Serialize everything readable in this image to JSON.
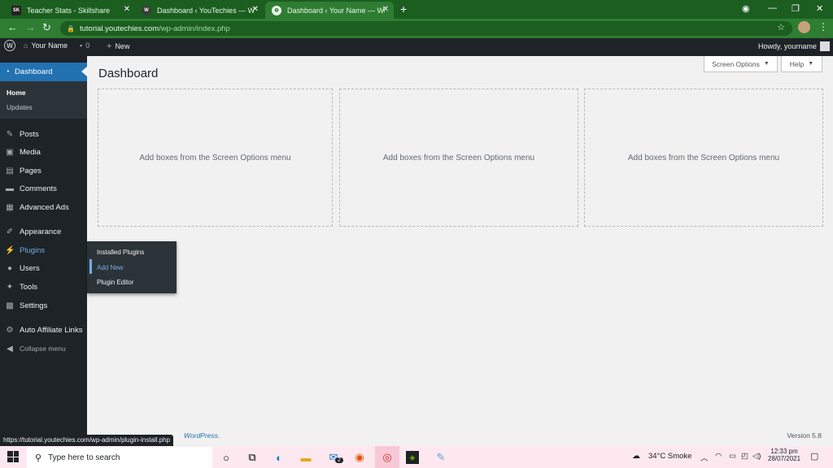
{
  "browser": {
    "tabs": [
      {
        "title": "Teacher Stats - Skillshare",
        "favicon": "SK",
        "active": false
      },
      {
        "title": "Dashboard ‹ YouTechies — Word",
        "favicon": "wordpress-icon",
        "active": false
      },
      {
        "title": "Dashboard ‹ Your Name — Word",
        "favicon": "globe-icon",
        "active": true
      }
    ],
    "new_tab_glyph": "+",
    "url_host": "tutorial.youtechies.com",
    "url_path": "/wp-admin/index.php"
  },
  "admin_bar": {
    "site_name": "Your Name",
    "comments_count": "0",
    "new_label": "New",
    "howdy": "Howdy, yourname"
  },
  "sidebar": {
    "dashboard_label": "Dashboard",
    "dashboard_sub": [
      "Home",
      "Updates"
    ],
    "items": [
      {
        "label": "Posts",
        "icon": "pin-icon"
      },
      {
        "label": "Media",
        "icon": "media-icon"
      },
      {
        "label": "Pages",
        "icon": "pages-icon"
      },
      {
        "label": "Comments",
        "icon": "comment-icon"
      },
      {
        "label": "Advanced Ads",
        "icon": "ads-icon"
      },
      {
        "label": "Appearance",
        "icon": "brush-icon"
      },
      {
        "label": "Plugins",
        "icon": "plug-icon"
      },
      {
        "label": "Users",
        "icon": "user-icon"
      },
      {
        "label": "Tools",
        "icon": "wrench-icon"
      },
      {
        "label": "Settings",
        "icon": "settings-icon"
      },
      {
        "label": "Auto Affiliate Links",
        "icon": "gear-icon"
      },
      {
        "label": "Collapse menu",
        "icon": "collapse-icon"
      }
    ],
    "plugins_flyout": [
      "Installed Plugins",
      "Add New",
      "Plugin Editor"
    ]
  },
  "main": {
    "title": "Dashboard",
    "screen_options_label": "Screen Options",
    "help_label": "Help",
    "box_text": "Add boxes from the Screen Options menu",
    "footer_link": "WordPress.",
    "version": "Version 5.8"
  },
  "status_url": "https://tutorial.youtechies.com/wp-admin/plugin-install.php",
  "taskbar": {
    "search_placeholder": "Type here to search",
    "weather": "34°C  Smoke",
    "time": "12:33 pm",
    "date": "28/07/2021",
    "mail_badge": "2"
  },
  "colors": {
    "accent": "#2271b1",
    "sidebar": "#1d2327",
    "hover": "#72aee6",
    "browser_frame": "#1b5e20"
  }
}
